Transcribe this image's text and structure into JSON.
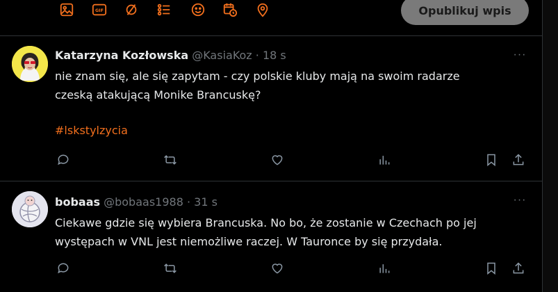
{
  "composer": {
    "publish_label": "Opublikuj wpis",
    "tools": [
      "image-icon",
      "gif-icon",
      "poll-icon",
      "list-icon",
      "emoji-icon",
      "schedule-icon",
      "location-icon"
    ],
    "accent_color": "#f26f1d"
  },
  "posts": [
    {
      "name": "Katarzyna Kozłowska",
      "handle": "@KasiaKoz",
      "separator": "·",
      "time": "18 s",
      "body_line1": "nie znam się, ale się zapytam - czy polskie kluby mają na swoim radarze",
      "body_line2": "czeską atakującą Monike Brancuskę?",
      "hashtag": "#lskstylzycia"
    },
    {
      "name": "bobaas",
      "handle": "@bobaas1988",
      "separator": "·",
      "time": "31 s",
      "body_line1": "Ciekawe gdzie się wybiera Brancuska. No bo, że zostanie w Czechach po jej",
      "body_line2": "występach w VNL jest niemożliwe raczej. W Tauronce by się przydała."
    }
  ],
  "more_label": "···"
}
